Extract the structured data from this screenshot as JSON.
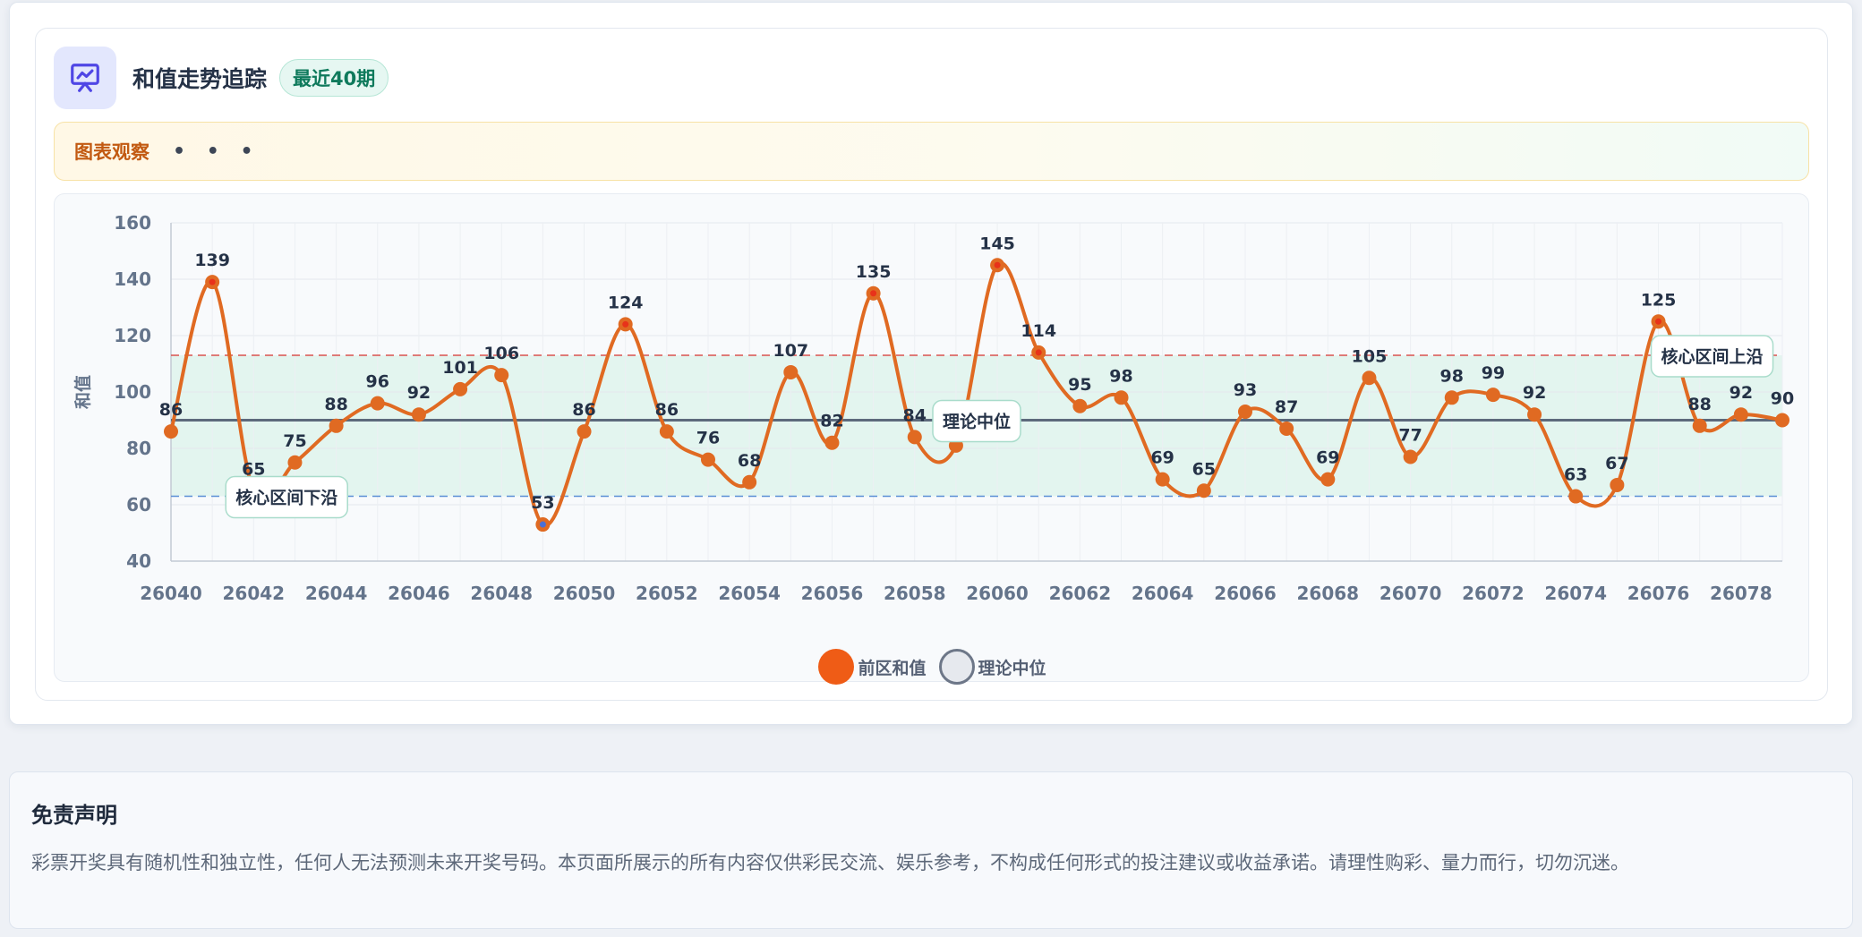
{
  "header": {
    "icon": "chart-presentation-icon",
    "title": "和值走势追踪",
    "badge": "最近40期"
  },
  "observation": {
    "label": "图表观察",
    "dots": "• • •"
  },
  "chart_data": {
    "type": "line",
    "ylabel": "和值",
    "ylim": [
      40,
      160
    ],
    "yticks": [
      40,
      60,
      80,
      100,
      120,
      140,
      160
    ],
    "x": [
      26040,
      26041,
      26042,
      26043,
      26044,
      26045,
      26046,
      26047,
      26048,
      26049,
      26050,
      26051,
      26052,
      26053,
      26054,
      26055,
      26056,
      26057,
      26058,
      26059,
      26060,
      26061,
      26062,
      26063,
      26064,
      26065,
      26066,
      26067,
      26068,
      26069,
      26070,
      26071,
      26072,
      26073,
      26074,
      26075,
      26076,
      26077,
      26078,
      26079
    ],
    "xticks": [
      "26040",
      "26042",
      "26044",
      "26046",
      "26048",
      "26050",
      "26052",
      "26054",
      "26056",
      "26058",
      "26060",
      "26062",
      "26064",
      "26066",
      "26068",
      "26070",
      "26072",
      "26074",
      "26076",
      "26078"
    ],
    "series": [
      {
        "name": "前区和值",
        "color": "#e06a22",
        "values": [
          86,
          139,
          65,
          75,
          88,
          96,
          92,
          101,
          106,
          53,
          86,
          124,
          86,
          76,
          68,
          107,
          82,
          135,
          84,
          81,
          145,
          114,
          95,
          98,
          69,
          65,
          93,
          87,
          69,
          105,
          77,
          98,
          99,
          92,
          63,
          67,
          125,
          88,
          92,
          90
        ]
      }
    ],
    "reference_lines": {
      "median": {
        "label": "理论中位",
        "value": 90,
        "color": "#5d6a7c"
      },
      "upper": {
        "label": "核心区间上沿",
        "value": 113,
        "color": "#d9534f"
      },
      "lower": {
        "label": "核心区间下沿",
        "value": 63,
        "color": "#5b8fd6"
      }
    },
    "band_color": "#dff3ec",
    "highlight_colors": {
      "high": "#e8321a",
      "low": "#4a6fd6"
    },
    "legend": [
      {
        "name": "前区和值",
        "color": "#ef5c16"
      },
      {
        "name": "理论中位",
        "color": "#6d7788"
      }
    ],
    "grid": true
  },
  "disclaimer": {
    "title": "免责声明",
    "text": "彩票开奖具有随机性和独立性，任何人无法预测未来开奖号码。本页面所展示的所有内容仅供彩民交流、娱乐参考，不构成任何形式的投注建议或收益承诺。请理性购彩、量力而行，切勿沉迷。"
  }
}
